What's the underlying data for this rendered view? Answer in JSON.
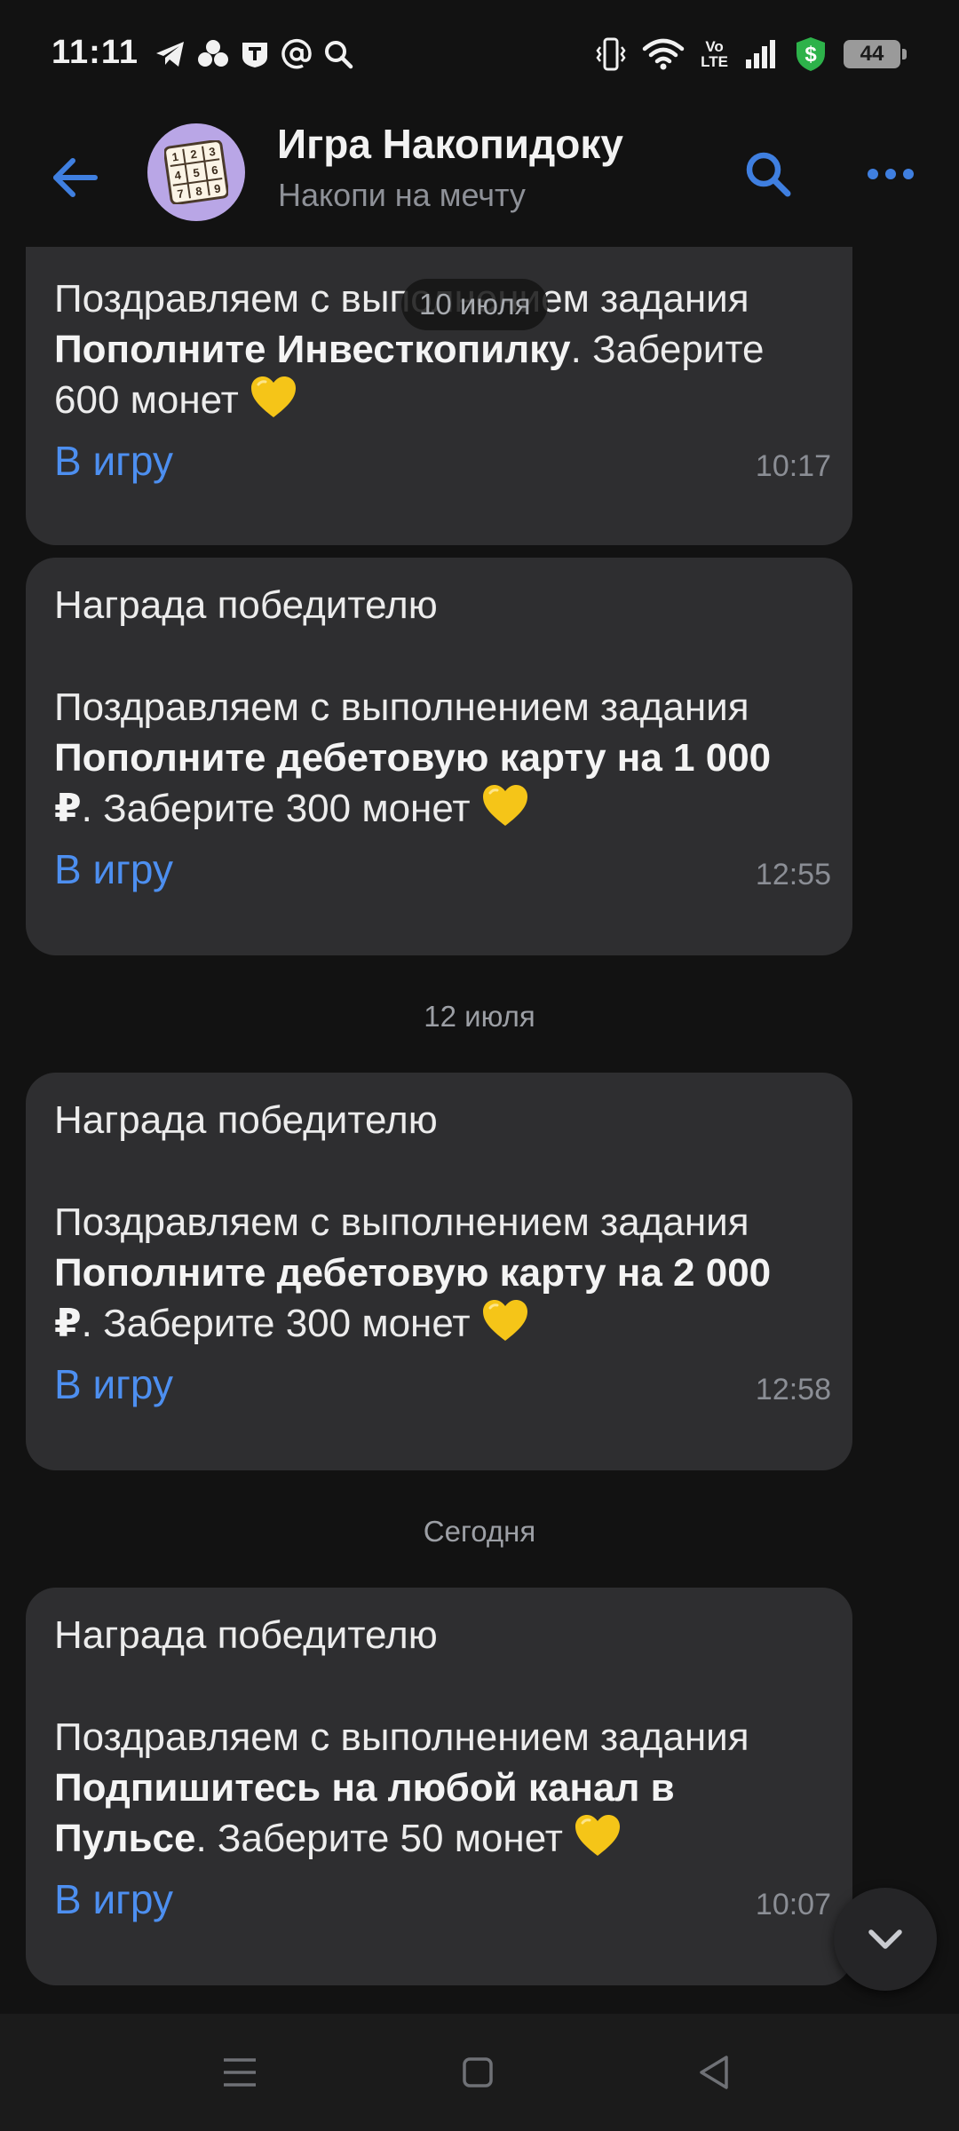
{
  "status_bar": {
    "time": "11:11",
    "left_icons": [
      "telegram-icon",
      "clover-icon",
      "t-badge-icon",
      "at-sign-icon",
      "search-icon"
    ],
    "right_icons": [
      "vibrate-icon",
      "wifi-icon",
      "volte-icon",
      "signal-icon",
      "shield-dollar-icon"
    ],
    "volte_top": "Vo",
    "volte_bottom": "LTE",
    "battery": "44"
  },
  "header": {
    "title": "Игра Накопидоку",
    "subtitle": "Накопи на мечту"
  },
  "floating_date": "10 июля",
  "messages": [
    {
      "lines": [
        [
          {
            "t": "Поздравляем с выполнением задания",
            "b": false
          }
        ],
        [
          {
            "t": "Пополните Инвесткопилку",
            "b": true
          },
          {
            "t": ". Заберите",
            "b": false
          }
        ],
        [
          {
            "t": "600 монет ",
            "b": false
          },
          {
            "t": "heart",
            "b": false
          }
        ]
      ],
      "link": "В игру",
      "time": "10:17"
    },
    {
      "title": "Награда победителю",
      "lines": [
        [
          {
            "t": "Поздравляем с выполнением задания",
            "b": false
          }
        ],
        [
          {
            "t": "Пополните дебетовую карту на 1 000",
            "b": true
          }
        ],
        [
          {
            "t": "₽",
            "b": true
          },
          {
            "t": ". Заберите 300 монет ",
            "b": false
          },
          {
            "t": "heart",
            "b": false
          }
        ]
      ],
      "link": "В игру",
      "time": "12:55"
    },
    {
      "date_before": "12 июля",
      "title": "Награда победителю",
      "lines": [
        [
          {
            "t": "Поздравляем с выполнением задания",
            "b": false
          }
        ],
        [
          {
            "t": "Пополните дебетовую карту на 2 000",
            "b": true
          }
        ],
        [
          {
            "t": "₽",
            "b": true
          },
          {
            "t": ". Заберите 300 монет ",
            "b": false
          },
          {
            "t": "heart",
            "b": false
          }
        ]
      ],
      "link": "В игру",
      "time": "12:58"
    },
    {
      "date_before": "Сегодня",
      "title": "Награда победителю",
      "lines": [
        [
          {
            "t": "Поздравляем с выполнением задания",
            "b": false
          }
        ],
        [
          {
            "t": "Подпишитесь на любой канал в",
            "b": true
          }
        ],
        [
          {
            "t": "Пульсе",
            "b": true
          },
          {
            "t": ". Заберите 50 монет ",
            "b": false
          },
          {
            "t": "heart",
            "b": false
          }
        ]
      ],
      "link": "В игру",
      "time": "10:07"
    }
  ],
  "colors": {
    "background": "#121212",
    "bubble": "#2e2e30",
    "link": "#4d8ff0",
    "accent": "#3f7fe0",
    "heart": "#f5c518"
  },
  "nav_icons": [
    "menu-icon",
    "home-icon",
    "back-triangle-icon"
  ]
}
